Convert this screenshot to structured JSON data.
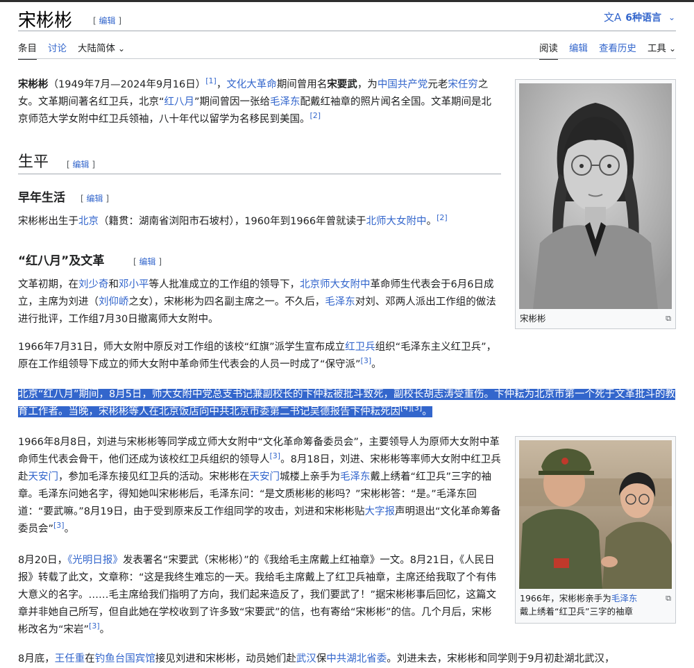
{
  "header": {
    "title": "宋彬彬",
    "edit_label": "编辑",
    "lang_icon": "文A",
    "lang_label": "6种语言",
    "lang_chevron": "⌵"
  },
  "tabs_left": [
    {
      "label": "条目"
    },
    {
      "label": "讨论"
    },
    {
      "label": "大陆简体"
    }
  ],
  "tabs_right": [
    {
      "label": "阅读"
    },
    {
      "label": "编辑"
    },
    {
      "label": "查看历史"
    },
    {
      "label": "工具"
    }
  ],
  "lead": {
    "name": "宋彬彬",
    "t1": "（1949年7月—2024年9月16日）",
    "ref1": "[1]",
    "t2": "，",
    "link_cr": "文化大革命",
    "t3": "期间曾用名",
    "alias": "宋要武",
    "t4": "，为",
    "link_ccp": "中国共产党",
    "t5": "元老",
    "link_srq": "宋任穷",
    "t6": "之女。文革期间著名红卫兵，北京“",
    "link_red_aug": "红八月",
    "t7": "”期间曾因一张给",
    "link_mao": "毛泽东",
    "t8": "配戴红袖章的照片闻名全国。文革期间是北京师范大学女附中红卫兵领袖，八十年代以留学为名移民到美国。",
    "ref2": "[2]"
  },
  "section_life": {
    "title": "生平",
    "edit": "编辑"
  },
  "section_early": {
    "title": "早年生活",
    "edit": "编辑",
    "t1": "宋彬彬出生于",
    "link_bj": "北京",
    "t2": "（籍贯：湖南省浏阳市石坡村），1960年到1966年曾就读于",
    "link_school": "北师大女附中",
    "t3": "。",
    "ref": "[2]"
  },
  "section_redaug": {
    "title": "“红八月”及文革",
    "edit": "编辑"
  },
  "p1": {
    "t1": "文革初期，在",
    "link_lsq": "刘少奇",
    "t2": "和",
    "link_dxp": "邓小平",
    "t3": "等人批准成立的工作组的领导下，",
    "link_school": "北京师大女附中",
    "t4": "革命师生代表会于6月6日成立，主席为刘进（",
    "link_lyq": "刘仰峤",
    "t5": "之女），宋彬彬为四名副主席之一。不久后，",
    "link_mao": "毛泽东",
    "t6": "对刘、邓两人派出工作组的做法进行批评，工作组7月30日撤离师大女附中。"
  },
  "p2": {
    "t1": "1966年7月31日，师大女附中原反对工作组的该校“红旗”派学生宣布成立",
    "link_hwb": "红卫兵",
    "t2": "组织“毛泽东主义红卫兵”，原在工作组领导下成立的师大女附中革命师生代表会的人员一时成了“保守派”",
    "ref": "[3]",
    "t3": "。"
  },
  "p3": {
    "text": "北京“红八月”期间，8月5日，师大女附中党总支书记兼副校长的卞仲耘被批斗致死，副校长胡志涛受重伤。卞仲耘为北京市第一个死于文革批斗的教育工作者。当晚，宋彬彬等人在北京饭店向中共北京市委第二书记吴德报告卞仲耘死因",
    "ref4": "[4]",
    "ref3": "[3]",
    "end": "。"
  },
  "p4": {
    "t1": "1966年8月8日，刘进与宋彬彬等同学成立师大女附中“文化革命筹备委员会”，主要领导人为原师大女附中革命师生代表会骨干，他们还成为该校红卫兵组织的领导人",
    "ref_a": "[3]",
    "t2": "。8月18日，刘进、宋彬彬等率师大女附中红卫兵赴",
    "link_tam1": "天安门",
    "t3": "，参加毛泽东接见红卫兵的活动。宋彬彬在",
    "link_tam2": "天安门",
    "t4": "城楼上亲手为",
    "link_mao": "毛泽东",
    "t5": "戴上绣着“红卫兵”三字的袖章。毛泽东问她名字，得知她叫宋彬彬后，毛泽东问：“是文质彬彬的彬吗？”宋彬彬答：“是。”毛泽东回道：“要武嘛。”8月19日，由于受到原来反工作组同学的攻击，刘进和宋彬彬贴",
    "link_dzb": "大字报",
    "t6": "声明退出“文化革命筹备委员会”",
    "ref_b": "[3]",
    "t7": "。"
  },
  "p5": {
    "t1": "8月20日，",
    "link_gmrb": "《光明日报》",
    "t2": "发表署名“宋要武（宋彬彬）”的《我给毛主席戴上红袖章》一文。8月21日，《人民日报》转载了此文，文章称：“这是我终生难忘的一天。我给毛主席戴上了红卫兵袖章，主席还给我取了个有伟大意义的名字。……毛主席给我们指明了方向，我们起来造反了，我们要武了！”据宋彬彬事后回忆，这篇文章并非她自己所写，但自此她在学校收到了许多致“宋要武”的信，也有寄给“宋彬彬”的信。几个月后，宋彬彬改名为“宋岩”",
    "ref": "[3]",
    "t3": "。"
  },
  "p6": {
    "t1": "8月底，",
    "link_wrz": "王任重",
    "t2": "在",
    "link_dyt": "钓鱼台国宾馆",
    "t3": "接见刘进和宋彬彬，动员她们赴",
    "link_wh": "武汉",
    "t4": "保",
    "link_hb": "中共湖北省委",
    "t5": "。刘进未去，宋彬彬和同学则于9月初赴湖北武汉，"
  },
  "figure1": {
    "caption": "宋彬彬",
    "icon": "enlarge-icon"
  },
  "figure2": {
    "caption_t1": "1966年，宋彬彬亲手为",
    "caption_link": "毛泽东",
    "caption_t2": "戴上绣着“红卫兵”三字的袖章",
    "icon": "enlarge-icon"
  },
  "colors": {
    "link": "#3366cc",
    "selection": "#3366cc",
    "text": "#202122"
  }
}
